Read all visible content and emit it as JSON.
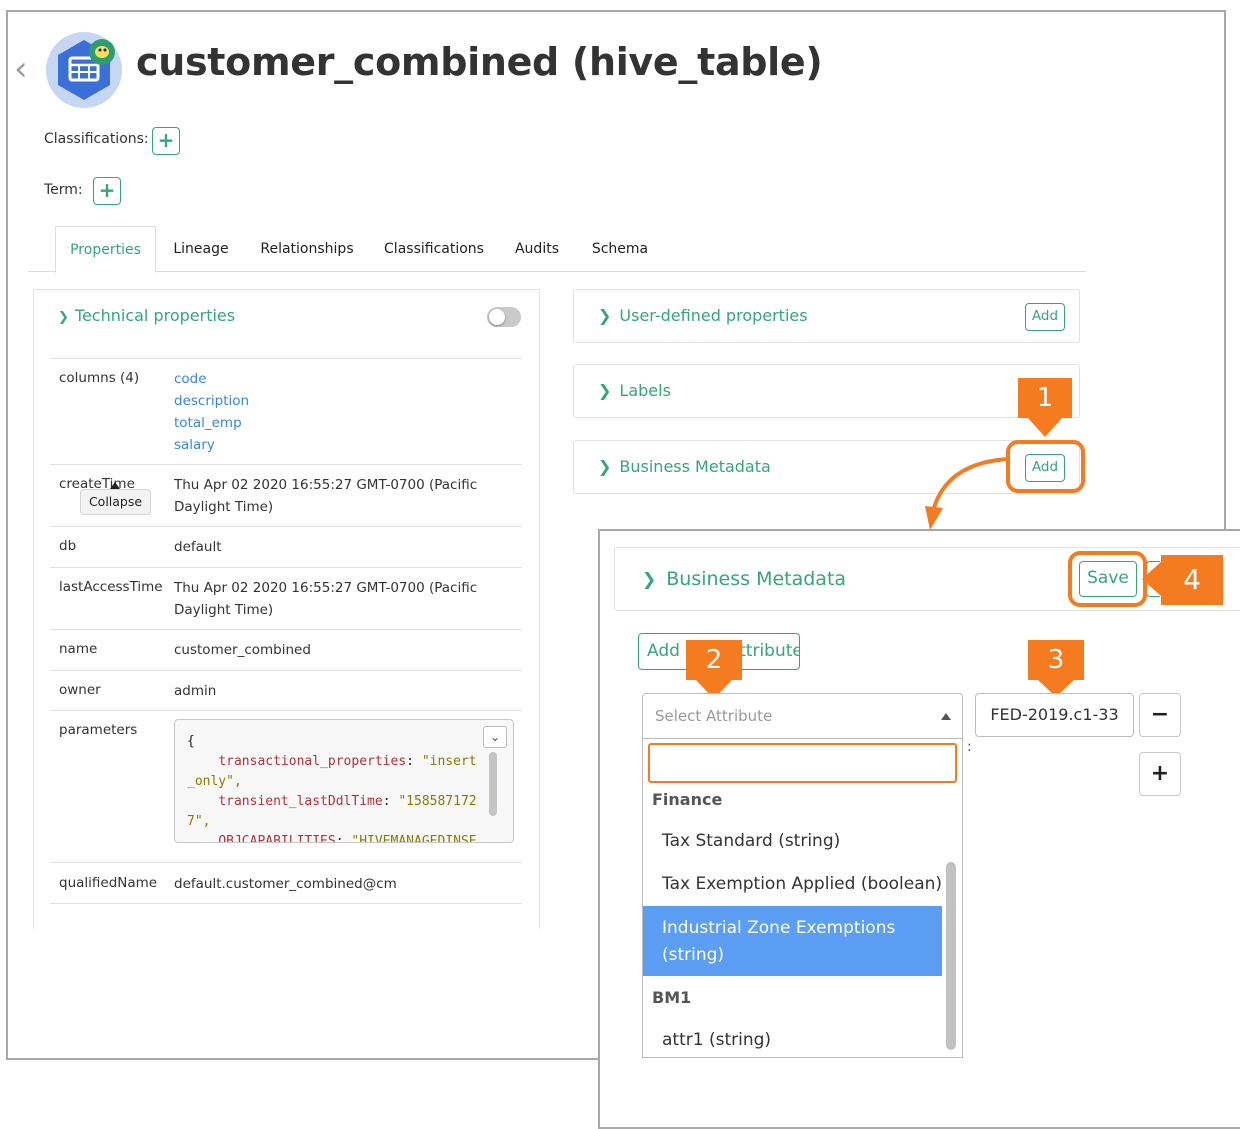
{
  "page": {
    "title": "customer_combined (hive_table)"
  },
  "meta": {
    "classifications_label": "Classifications:",
    "term_label": "Term:",
    "add_symbol": "+"
  },
  "tabs": [
    "Properties",
    "Lineage",
    "Relationships",
    "Classifications",
    "Audits",
    "Schema"
  ],
  "technical": {
    "header": "Technical properties",
    "tooltip": "Collapse",
    "rows": [
      {
        "key": "columns (4)",
        "values": [
          "code",
          "description",
          "total_emp",
          "salary"
        ]
      },
      {
        "key": "createTime",
        "value": "Thu Apr 02 2020 16:55:27 GMT-0700 (Pacific Daylight Time)"
      },
      {
        "key": "db",
        "value": "default"
      },
      {
        "key": "lastAccessTime",
        "value": "Thu Apr 02 2020 16:55:27 GMT-0700 (Pacific Daylight Time)"
      },
      {
        "key": "name",
        "value": "customer_combined"
      },
      {
        "key": "owner",
        "value": "admin"
      },
      {
        "key": "parameters",
        "value": ""
      },
      {
        "key": "qualifiedName",
        "value": "default.customer_combined@cm"
      }
    ],
    "parameters_json": [
      {
        "text": "{"
      },
      {
        "key": "transactional_properties",
        "value": "\"insert_only\","
      },
      {
        "key": "transient_lastDdlTime",
        "value": "\"1585871727\","
      },
      {
        "key": "OBJCAPABILITIES",
        "value": "\"HIVEMANAGEDINSERTREAD,HIVEMANAGEDINSERTWRITE\","
      }
    ]
  },
  "side_panels": {
    "user_defined": "User-defined properties",
    "labels": "Labels",
    "business_metadata": "Business Metadata",
    "add_label": "Add"
  },
  "callouts": [
    "1",
    "2",
    "3",
    "4"
  ],
  "zoom": {
    "title": "Business Metadata",
    "save_label": "Save",
    "add_attribute_label": "Add New Attribute",
    "select_placeholder": "Select Attribute",
    "value": "FED-2019.c1-33",
    "colon": ":",
    "minus": "−",
    "plus": "+",
    "options": {
      "group1": "Finance",
      "opt1": "Tax Standard (string)",
      "opt2": "Tax Exemption Applied (boolean)",
      "opt3": "Industrial Zone Exemptions (string)",
      "group2": "BM1",
      "opt4": "attr1 (string)"
    }
  },
  "colors": {
    "accent": "#38a47a",
    "link": "#3a87d6",
    "callout": "#f47b20",
    "highlight": "#5b9ef3",
    "icon": "#3a6fd8"
  }
}
